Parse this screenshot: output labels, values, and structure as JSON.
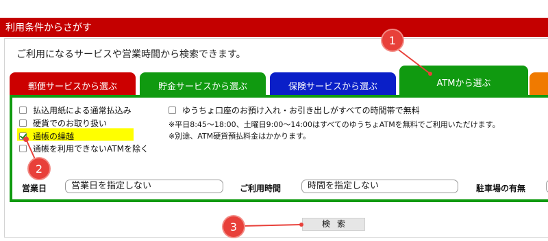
{
  "header": {
    "title": "利用条件からさがす"
  },
  "intro": "ご利用になるサービスや営業時間から検索できます。",
  "tabs": [
    {
      "label": "郵便サービスから選ぶ",
      "color": "#cc0000"
    },
    {
      "label": "貯金サービスから選ぶ",
      "color": "#109a10"
    },
    {
      "label": "保険サービスから選ぶ",
      "color": "#0a1fc8"
    },
    {
      "label": "ATMから選ぶ",
      "color": "#109a10",
      "active": true
    },
    {
      "label": "",
      "color": "#f07a00"
    }
  ],
  "checkboxes_left": [
    {
      "label": "払込用紙による通常払込み",
      "checked": false
    },
    {
      "label": "硬貨でのお取り扱い",
      "checked": false
    },
    {
      "label": "通帳の繰越",
      "checked": true
    },
    {
      "label": "通帳を利用できないATMを除く",
      "checked": false
    }
  ],
  "checkbox_right": {
    "label": "ゆうちょ口座のお預け入れ・お引き出しがすべての時間帯で無料",
    "checked": false
  },
  "notes": [
    "※平日8:45～18:00、土曜日9:00～14:00はすべてのゆうちょATMを無料でご利用いただけます。",
    "※別途、ATM硬貨預払料金はかかります。"
  ],
  "filters": {
    "business_day_label": "営業日",
    "business_day_value": "営業日を指定しない",
    "hours_label": "ご利用時間",
    "hours_value": "時間を指定しない",
    "parking_label": "駐車場の有無"
  },
  "search_button": "検索",
  "callouts": [
    "1",
    "2",
    "3"
  ],
  "colors": {
    "header": "#c40000",
    "highlight": "#ffff00",
    "callout": "#e8403a"
  }
}
